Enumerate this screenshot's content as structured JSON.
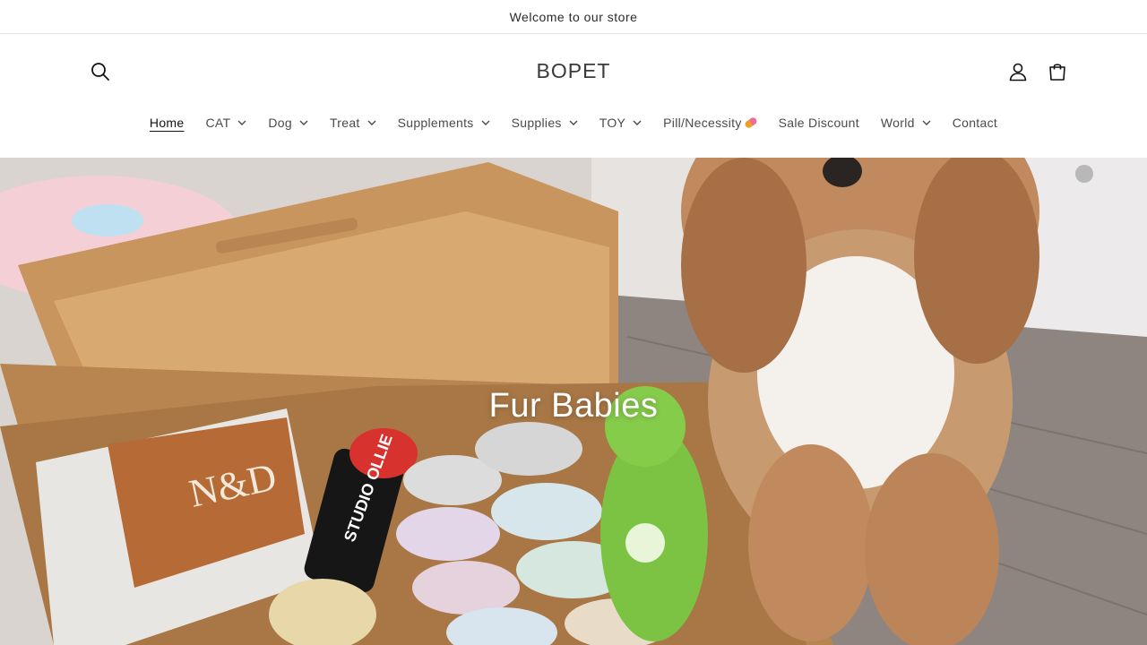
{
  "announcement": {
    "text": "Welcome to our store"
  },
  "header": {
    "logo": "BOPET",
    "search_icon": "search-icon",
    "account_icon": "user-icon",
    "cart_icon": "cart-icon"
  },
  "nav": {
    "items": [
      {
        "label": "Home",
        "has_dropdown": false,
        "active": true
      },
      {
        "label": "CAT",
        "has_dropdown": true
      },
      {
        "label": "Dog",
        "has_dropdown": true
      },
      {
        "label": "Treat",
        "has_dropdown": true
      },
      {
        "label": "Supplements",
        "has_dropdown": true
      },
      {
        "label": "Supplies",
        "has_dropdown": true
      },
      {
        "label": "TOY",
        "has_dropdown": true
      },
      {
        "label": "Pill/Necessity",
        "has_dropdown": false,
        "icon": "pill-emoji"
      },
      {
        "label": "Sale Discount",
        "has_dropdown": false
      },
      {
        "label": "World",
        "has_dropdown": true
      },
      {
        "label": "Contact",
        "has_dropdown": false
      }
    ]
  },
  "hero": {
    "caption": "Fur Babies"
  },
  "colors": {
    "text": "#121212",
    "muted": "#4a4a4a",
    "border": "#e6e6e6",
    "background": "#ffffff"
  }
}
